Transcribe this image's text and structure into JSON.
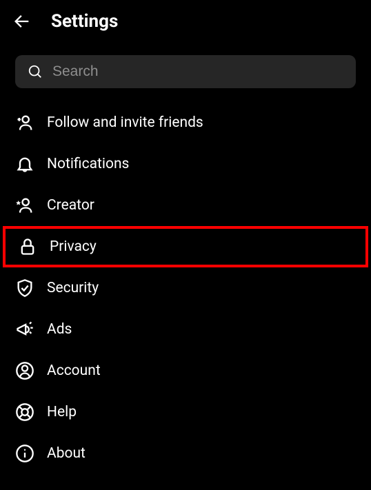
{
  "header": {
    "title": "Settings"
  },
  "search": {
    "placeholder": "Search",
    "value": ""
  },
  "menu": {
    "items": [
      {
        "label": "Follow and invite friends"
      },
      {
        "label": "Notifications"
      },
      {
        "label": "Creator"
      },
      {
        "label": "Privacy"
      },
      {
        "label": "Security"
      },
      {
        "label": "Ads"
      },
      {
        "label": "Account"
      },
      {
        "label": "Help"
      },
      {
        "label": "About"
      }
    ]
  },
  "highlighted_index": 3
}
